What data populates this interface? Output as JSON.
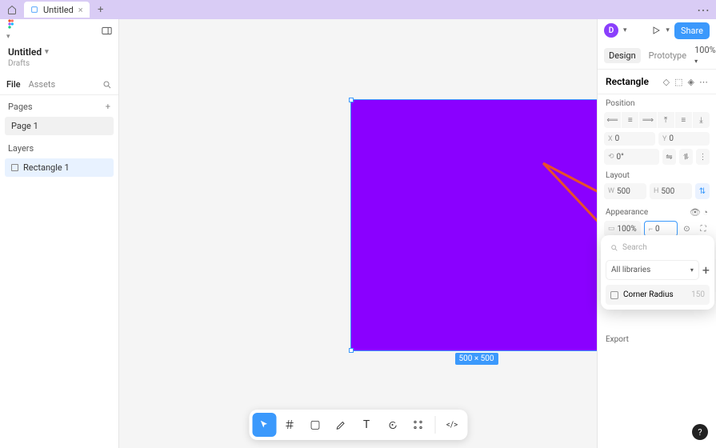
{
  "topbar": {
    "tab_title": "Untitled",
    "tab_close": "×",
    "plus": "+",
    "more": "⋯"
  },
  "leftpanel": {
    "filename": "Untitled",
    "team": "Drafts",
    "tab_file": "File",
    "tab_assets": "Assets",
    "pages_label": "Pages",
    "page1": "Page 1",
    "layers_label": "Layers",
    "layer1": "Rectangle 1"
  },
  "canvas": {
    "dim_label": "500 × 500"
  },
  "toolbar": {
    "move": "▶",
    "frame": "＃",
    "rect": "▢",
    "pen": "✎",
    "text": "T",
    "comment": "💬",
    "actions": "⌘",
    "dev": "</>"
  },
  "rightpanel": {
    "avatar": "D",
    "share": "Share",
    "tab_design": "Design",
    "tab_proto": "Prototype",
    "zoom": "100%",
    "selection": "Rectangle",
    "position_label": "Position",
    "x_label": "X",
    "x_val": "0",
    "y_label": "Y",
    "y_val": "0",
    "rot_label": "⟲",
    "rot_val": "0°",
    "layout_label": "Layout",
    "w_label": "W",
    "w_val": "500",
    "h_label": "H",
    "h_val": "500",
    "appearance_label": "Appearance",
    "opacity": "100%",
    "radius_label": "⌐",
    "radius_val": "0",
    "export_label": "Export"
  },
  "dropdown": {
    "search_placeholder": "Search",
    "all_libs": "All libraries",
    "item_label": "Corner Radius",
    "item_val": "150"
  },
  "help": "?"
}
